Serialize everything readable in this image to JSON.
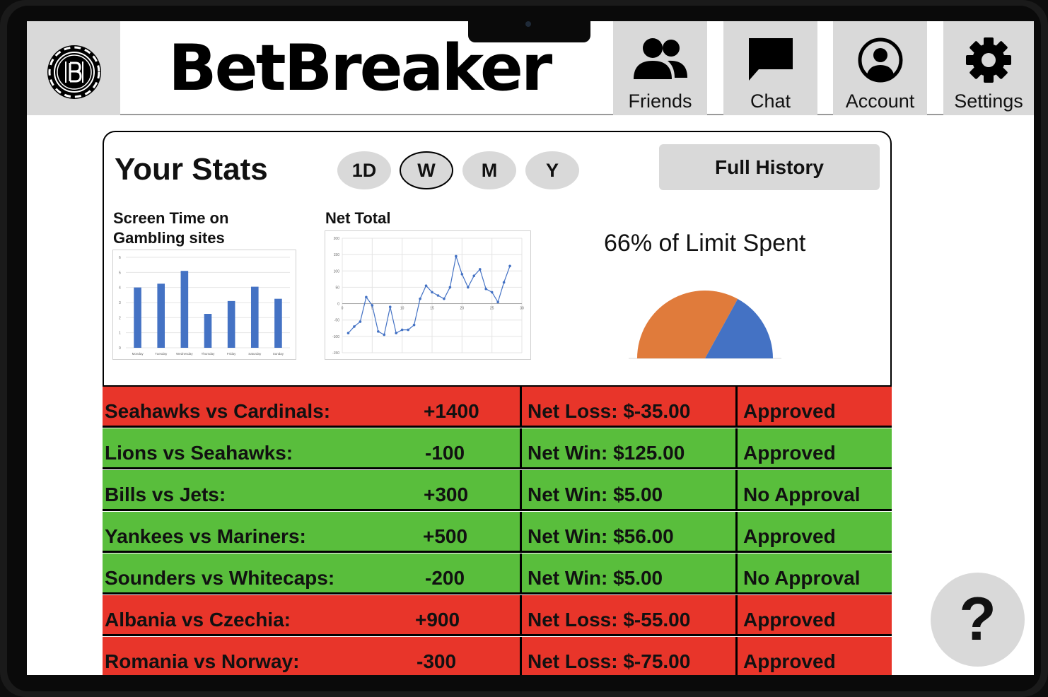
{
  "app": {
    "brand": "BetBreaker"
  },
  "nav": [
    {
      "label": "Friends",
      "icon": "friends-icon"
    },
    {
      "label": "Chat",
      "icon": "chat-icon"
    },
    {
      "label": "Account",
      "icon": "account-icon"
    },
    {
      "label": "Settings",
      "icon": "gear-icon"
    }
  ],
  "stats": {
    "title": "Your Stats",
    "periods": [
      "1D",
      "W",
      "M",
      "Y"
    ],
    "selected_period": "W",
    "history_button": "Full History",
    "screen_time_title": "Screen Time on Gambling sites",
    "net_total_title": "Net Total",
    "limit_text": "66% of Limit Spent"
  },
  "chart_data": [
    {
      "type": "bar",
      "title": "Screen Time on Gambling sites",
      "categories": [
        "Monday",
        "Tuesday",
        "Wednesday",
        "Thursday",
        "Friday",
        "Saturday",
        "Sunday"
      ],
      "values": [
        4.0,
        4.25,
        5.1,
        2.25,
        3.1,
        4.05,
        3.25
      ],
      "ylim": [
        0,
        6
      ],
      "yticks": [
        0,
        1,
        2,
        3,
        4,
        5,
        6
      ],
      "color": "#4472c4",
      "grid": true
    },
    {
      "type": "line",
      "title": "Net Total",
      "x": [
        1,
        2,
        3,
        4,
        5,
        6,
        7,
        8,
        9,
        10,
        11,
        12,
        13,
        14,
        15,
        16,
        17,
        18,
        19,
        20,
        21,
        22,
        23,
        24,
        25,
        26,
        27,
        28
      ],
      "y": [
        -90,
        -70,
        -55,
        20,
        -5,
        -85,
        -95,
        -10,
        -90,
        -80,
        -80,
        -65,
        15,
        55,
        35,
        25,
        15,
        50,
        145,
        90,
        50,
        85,
        105,
        45,
        35,
        5,
        65,
        115
      ],
      "xlim": [
        0,
        30
      ],
      "xticks": [
        0,
        5,
        10,
        15,
        20,
        25,
        30
      ],
      "ylim": [
        -150,
        200
      ],
      "yticks": [
        -150,
        -100,
        -50,
        0,
        50,
        100,
        150,
        200
      ],
      "color": "#4472c4",
      "grid": true
    },
    {
      "type": "pie",
      "title": "66% of Limit Spent",
      "values": [
        66,
        34
      ],
      "colors": [
        "#e07b3b",
        "#4472c4"
      ]
    }
  ],
  "bets": [
    {
      "match": "Seahawks vs Cardinals:",
      "odds": "+1400",
      "net": "Net Loss: $-35.00",
      "status": "Approved",
      "result": "loss"
    },
    {
      "match": "Lions vs Seahawks:",
      "odds": "-100",
      "net": "Net Win: $125.00",
      "status": "Approved",
      "result": "win"
    },
    {
      "match": "Bills vs Jets:",
      "odds": "+300",
      "net": "Net Win: $5.00",
      "status": "No Approval",
      "result": "win"
    },
    {
      "match": "Yankees vs Mariners:",
      "odds": "+500",
      "net": "Net Win: $56.00",
      "status": "Approved",
      "result": "win"
    },
    {
      "match": "Sounders vs Whitecaps:",
      "odds": "-200",
      "net": "Net Win: $5.00",
      "status": "No Approval",
      "result": "win"
    },
    {
      "match": "Albania vs Czechia:",
      "odds": "+900",
      "net": "Net Loss: $-55.00",
      "status": "Approved",
      "result": "loss"
    },
    {
      "match": "Romania vs Norway:",
      "odds": "-300",
      "net": "Net Loss: $-75.00",
      "status": "Approved",
      "result": "loss"
    }
  ],
  "help": {
    "label": "?"
  }
}
